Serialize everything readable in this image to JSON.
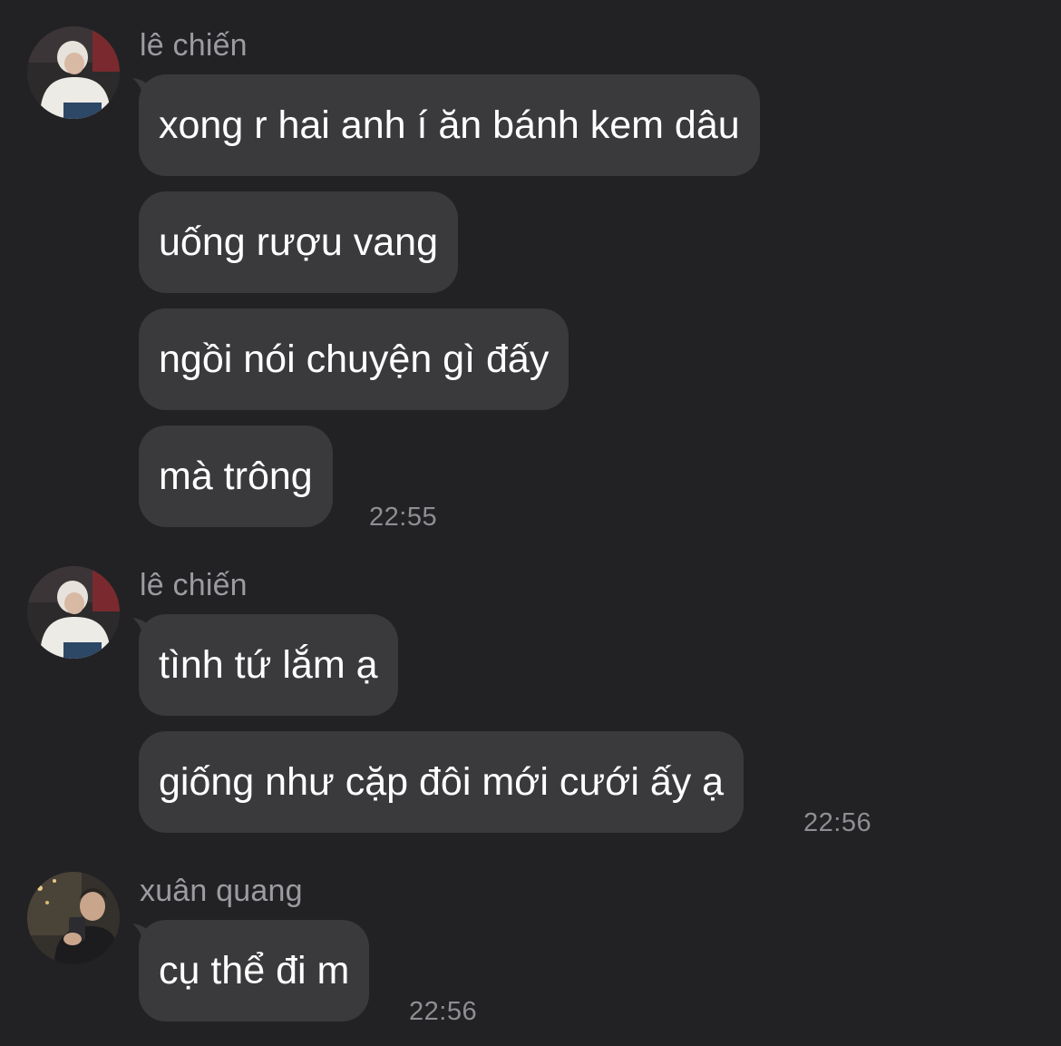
{
  "groups": [
    {
      "sender": "lê chiến",
      "messages": [
        "xong r hai anh í ăn bánh kem dâu",
        "uống rượu vang",
        "ngồi nói chuyện gì đấy",
        "mà trông"
      ],
      "time": "22:55"
    },
    {
      "sender": "lê chiến",
      "messages": [
        "tình tứ lắm ạ",
        "giống như cặp đôi mới cưới ấy ạ"
      ],
      "time": "22:56"
    },
    {
      "sender": "xuân quang",
      "messages": [
        "cụ thể đi m"
      ],
      "time": "22:56"
    }
  ],
  "colors": {
    "background": "#222225",
    "bubble": "#3a3a3d",
    "text": "#ffffff",
    "meta": "#9b9ba0"
  }
}
